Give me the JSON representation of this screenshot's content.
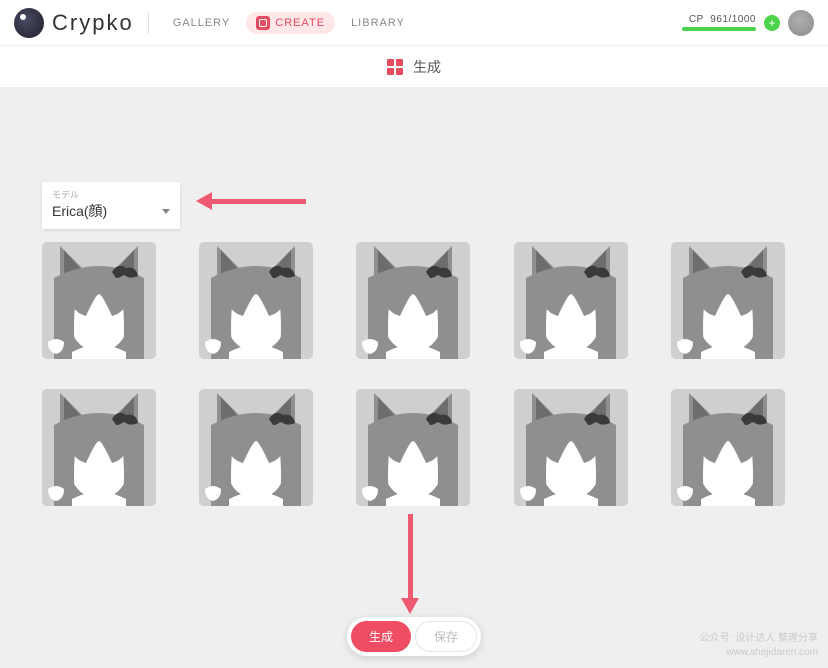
{
  "header": {
    "brand": "Crypko",
    "nav": {
      "gallery": "GALLERY",
      "create": "CREATE",
      "library": "LIBRARY"
    },
    "cp_label": "CP",
    "cp_value": "961/1000"
  },
  "subheader": {
    "title": "生成"
  },
  "model_select": {
    "label": "モデル",
    "value": "Erica(顔)"
  },
  "grid": {
    "count": 10
  },
  "buttons": {
    "generate": "生成",
    "save": "保存"
  },
  "watermark": {
    "line1": "公众号: 设计达人 整理分享",
    "line2": "www.shejidaren.com"
  }
}
